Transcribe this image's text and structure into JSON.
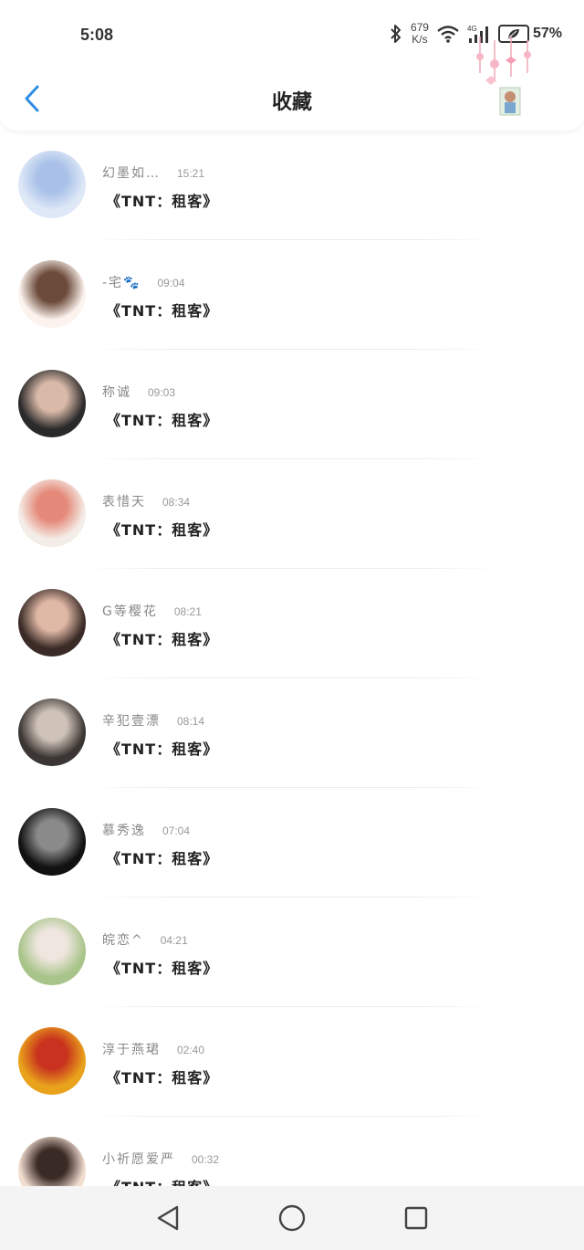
{
  "status_bar": {
    "time": "5:08",
    "net_speed_value": "679",
    "net_speed_unit": "K/s",
    "network_type": "4G",
    "battery_percent": "57%",
    "icons": [
      "bluetooth-icon",
      "wifi-icon",
      "signal-icon",
      "battery-icon"
    ]
  },
  "header": {
    "title": "收藏",
    "back_icon": "chevron-left-icon"
  },
  "accent_color": "#2f8de4",
  "items": [
    {
      "nickname": "幻墨如…",
      "time": "15:21",
      "content": "《TNT：租客》",
      "avatar_colors": [
        "#dfe8f7",
        "#a9c1e8"
      ]
    },
    {
      "nickname": "-宅🐾",
      "time": "09:04",
      "content": "《TNT：租客》",
      "avatar_colors": [
        "#fdf3ee",
        "#6b4a3a"
      ]
    },
    {
      "nickname": "称诚",
      "time": "09:03",
      "content": "《TNT：租客》",
      "avatar_colors": [
        "#2a2a2a",
        "#d9b9a8"
      ]
    },
    {
      "nickname": "表惜天",
      "time": "08:34",
      "content": "《TNT：租客》",
      "avatar_colors": [
        "#f4ece6",
        "#e58a7a"
      ]
    },
    {
      "nickname": "G等樱花",
      "time": "08:21",
      "content": "《TNT：租客》",
      "avatar_colors": [
        "#3a2b26",
        "#e0b8a6"
      ]
    },
    {
      "nickname": "辛犯壹漂",
      "time": "08:14",
      "content": "《TNT：租客》",
      "avatar_colors": [
        "#3b3633",
        "#cfc2b8"
      ]
    },
    {
      "nickname": "慕秀逸",
      "time": "07:04",
      "content": "《TNT：租客》",
      "avatar_colors": [
        "#111111",
        "#8a8a8a"
      ]
    },
    {
      "nickname": "皖恋^",
      "time": "04:21",
      "content": "《TNT：租客》",
      "avatar_colors": [
        "#a9c48a",
        "#efe6e0"
      ]
    },
    {
      "nickname": "淳于燕珺",
      "time": "02:40",
      "content": "《TNT：租客》",
      "avatar_colors": [
        "#e9a21c",
        "#c8321e"
      ]
    },
    {
      "nickname": "小祈愿爱严",
      "time": "00:32",
      "content": "《TNT：租客》",
      "avatar_colors": [
        "#f2ddd0",
        "#3a2a25"
      ]
    }
  ],
  "nav_bar": {
    "buttons": [
      "back-triangle-icon",
      "home-circle-icon",
      "recents-square-icon"
    ]
  }
}
